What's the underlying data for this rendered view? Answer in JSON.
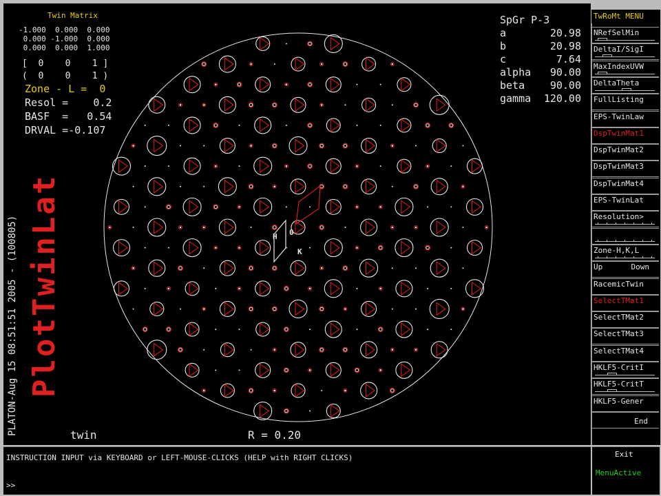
{
  "twin_matrix": {
    "title": "Twin Matrix",
    "rows": [
      "-1.000  0.000  0.000",
      " 0.000 -1.000  0.000",
      " 0.000  0.000  1.000"
    ],
    "bracket1": "[  0    0    1 ]",
    "bracket2": "(  0    0    1 )",
    "zone": "Zone - L =  0",
    "resol": "Resol =    0.2",
    "basf": "BASF  =   0.54",
    "drval": "DRVAL =-0.107"
  },
  "cell": {
    "spgr": "SpGr P-3",
    "params": [
      {
        "label": "a",
        "value": "20.98"
      },
      {
        "label": "b",
        "value": "20.98"
      },
      {
        "label": "c",
        "value": "7.64"
      },
      {
        "label": "alpha",
        "value": "90.00"
      },
      {
        "label": "beta",
        "value": "90.00"
      },
      {
        "label": "gamma",
        "value": "120.00"
      }
    ]
  },
  "side": {
    "program_line": "PLATON-Aug 15 08:51:51 2005  - (100805)",
    "big_title": "PlotTwinLat"
  },
  "axes": {
    "h": "H",
    "k": "K",
    "origin": "0"
  },
  "footer": {
    "left": "twin",
    "r_value": "R = 0.20"
  },
  "colors": {
    "spot": "#e8e8e8",
    "twin": "#e02020",
    "accent": "#e8d000"
  },
  "menu": {
    "title": "TwRoMt MENU",
    "items": [
      {
        "label": "NRefSelMin",
        "slider": 0.05,
        "active": false
      },
      {
        "label": "DeltaI/SigI",
        "slider": 0.15,
        "active": false
      },
      {
        "label": "MaxIndexUVW",
        "slider": 0.05,
        "active": false
      },
      {
        "label": "DeltaTheta",
        "slider": 0.55,
        "active": false
      },
      {
        "label": "FullListing",
        "active": false
      },
      {
        "label": "EPS-TwinLaw",
        "active": false
      },
      {
        "label": "DspTwinMat1",
        "active": true
      },
      {
        "label": "DspTwinMat2",
        "active": false
      },
      {
        "label": "DspTwinMat3",
        "active": false
      },
      {
        "label": "DspTwinMat4",
        "active": false
      },
      {
        "label": "EPS-TwinLat",
        "active": false
      },
      {
        "label": "Resolution>",
        "ruler": true,
        "active": false
      },
      {
        "label": "",
        "ruler": true,
        "active": false
      },
      {
        "label": "Zone-H,K,L",
        "ruler": true,
        "active": false
      },
      {
        "label": "Up",
        "right": "Down",
        "active": false
      },
      {
        "label": "RacemicTwin",
        "active": false
      },
      {
        "label": "SelectTMat1",
        "active": true
      },
      {
        "label": "SelectTMat2",
        "active": false
      },
      {
        "label": "SelectTMat3",
        "active": false
      },
      {
        "label": "SelectTMat4",
        "active": false
      },
      {
        "label": "HKLF5-CritI",
        "slider": 0.25,
        "active": false
      },
      {
        "label": "HKLF5-CritT",
        "slider": 0.25,
        "active": false
      },
      {
        "label": "HKLF5-Gener",
        "active": false
      },
      {
        "label": "End",
        "align": "right",
        "active": false
      }
    ]
  },
  "input": {
    "instruction": "INSTRUCTION INPUT via KEYBOARD or LEFT-MOUSE-CLICKS (HELP with RIGHT CLICKS)",
    "prompt": ">>"
  },
  "status": {
    "exit": "Exit",
    "menu_active": "MenuActive"
  }
}
